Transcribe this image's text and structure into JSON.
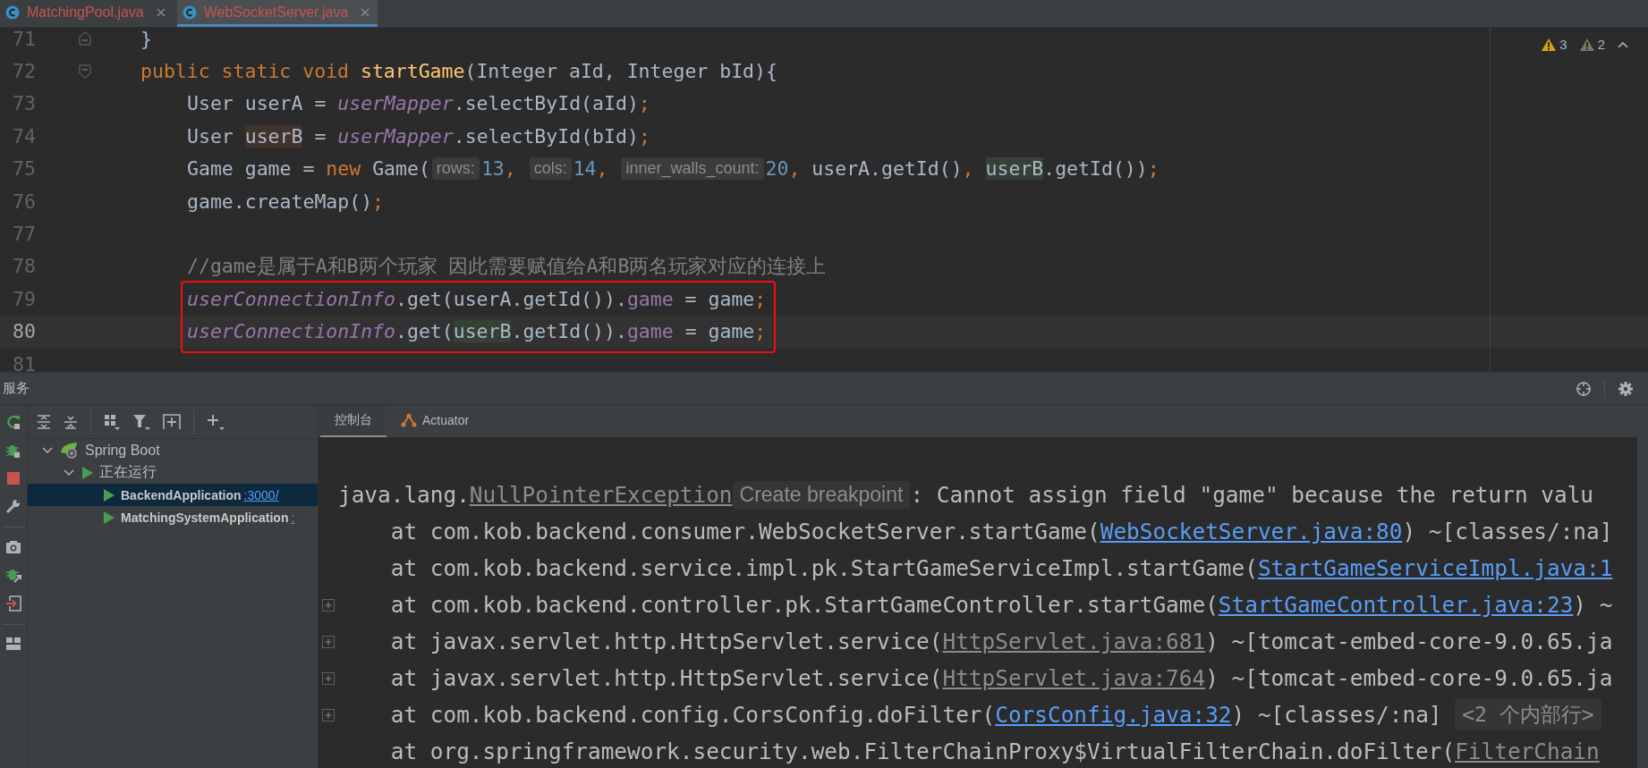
{
  "tabs": [
    {
      "label": "MatchingPool.java",
      "selected": false
    },
    {
      "label": "WebSocketServer.java",
      "selected": true
    }
  ],
  "editor": {
    "inspections": [
      {
        "kind": "warning",
        "count": "3"
      },
      {
        "kind": "weak_warning",
        "count": "2"
      }
    ],
    "lines": [
      {
        "number": "71",
        "current": false,
        "boxed": false,
        "fold": {
          "kind": "end"
        },
        "tokens": [
          {
            "t": "}",
            "kind": "plain"
          }
        ]
      },
      {
        "number": "72",
        "current": false,
        "boxed": false,
        "fold": {
          "kind": "start"
        },
        "tokens": [
          {
            "t": "public static void ",
            "kind": "kw"
          },
          {
            "t": "startGame",
            "kind": "fn"
          },
          {
            "t": "(Integer aId, Integer bId){",
            "kind": "plain"
          }
        ],
        "children": [
          {
            "number": "73",
            "current": false,
            "boxed": false,
            "tokens": [
              {
                "t": "User userA = ",
                "kind": "plain"
              },
              {
                "t": "userMapper",
                "kind": "field"
              },
              {
                "t": ".selectById(aId)",
                "kind": "plain"
              },
              {
                "t": ";",
                "kind": "punct"
              }
            ]
          },
          {
            "number": "74",
            "current": false,
            "boxed": false,
            "tokens": [
              {
                "t": "User ",
                "kind": "plain"
              },
              {
                "t": "userB",
                "kind": "usage_write"
              },
              {
                "t": " = ",
                "kind": "plain"
              },
              {
                "t": "userMapper",
                "kind": "field"
              },
              {
                "t": ".selectById(bId)",
                "kind": "plain"
              },
              {
                "t": ";",
                "kind": "punct"
              }
            ]
          },
          {
            "number": "75",
            "current": false,
            "boxed": false,
            "tokens": [
              {
                "t": "Game game = ",
                "kind": "plain"
              },
              {
                "t": "new ",
                "kind": "kw"
              },
              {
                "t": "Game(",
                "kind": "plain"
              },
              {
                "t": "rows:",
                "kind": "hint"
              },
              {
                "t": "13",
                "kind": "num"
              },
              {
                "t": ", ",
                "kind": "punct"
              },
              {
                "t": "cols:",
                "kind": "hint"
              },
              {
                "t": "14",
                "kind": "num"
              },
              {
                "t": ", ",
                "kind": "punct"
              },
              {
                "t": "inner_walls_count:",
                "kind": "hint"
              },
              {
                "t": "20",
                "kind": "num"
              },
              {
                "t": ", ",
                "kind": "punct"
              },
              {
                "t": "userA.getId()",
                "kind": "plain"
              },
              {
                "t": ", ",
                "kind": "punct"
              },
              {
                "t": "userB",
                "kind": "usage_read"
              },
              {
                "t": ".getId())",
                "kind": "plain"
              },
              {
                "t": ";",
                "kind": "punct"
              }
            ]
          },
          {
            "number": "76",
            "current": false,
            "boxed": false,
            "tokens": [
              {
                "t": "game.createMap()",
                "kind": "plain"
              },
              {
                "t": ";",
                "kind": "punct"
              }
            ]
          },
          {
            "number": "77",
            "current": false,
            "boxed": false
          },
          {
            "number": "78",
            "current": false,
            "boxed": false,
            "tokens": [
              {
                "t": "//game是属于A和B两个玩家 因此需要赋值给A和B两名玩家对应的连接上",
                "kind": "comment"
              }
            ]
          },
          {
            "number": "79",
            "current": false,
            "boxed": true,
            "tokens": [
              {
                "t": "userConnectionInfo",
                "kind": "field"
              },
              {
                "t": ".get(userA.getId()).",
                "kind": "plain"
              },
              {
                "t": "game",
                "kind": "prop"
              },
              {
                "t": " = game",
                "kind": "plain"
              },
              {
                "t": ";",
                "kind": "punct"
              }
            ]
          },
          {
            "number": "80",
            "current": true,
            "boxed": true,
            "tokens": [
              {
                "t": "userConnectionInfo",
                "kind": "field"
              },
              {
                "t": ".get(",
                "kind": "plain"
              },
              {
                "t": "userB",
                "kind": "usage_read"
              },
              {
                "t": ".getId()).",
                "kind": "plain"
              },
              {
                "t": "game",
                "kind": "prop"
              },
              {
                "t": " = game",
                "kind": "plain"
              },
              {
                "t": ";",
                "kind": "punct"
              }
            ]
          },
          {
            "number": "81",
            "current": false,
            "boxed": false
          }
        ]
      }
    ]
  },
  "services": {
    "title": "服务",
    "tree": [
      {
        "label": "Spring Boot",
        "expanded": true,
        "children": [
          {
            "label": "正在运行",
            "expanded": true,
            "children": [
              {
                "label": "BackendApplication",
                "link": ":3000/",
                "selected": true
              },
              {
                "label": "MatchingSystemApplication",
                "link": ":",
                "selected": false
              }
            ]
          }
        ]
      }
    ],
    "console_tabs": [
      {
        "label": "控制台",
        "selected": true
      },
      {
        "label": "Actuator",
        "selected": false
      }
    ],
    "console": [
      {
        "foldable": false,
        "tokens": [
          {
            "t": "java.lang.",
            "kind": "text"
          },
          {
            "t": "NullPointerException",
            "kind": "grey_link"
          },
          {
            "t": "Create breakpoint",
            "kind": "hint"
          },
          {
            "t": ": Cannot assign field \"game\" because the return valu",
            "kind": "text"
          }
        ]
      },
      {
        "foldable": false,
        "tokens": [
          {
            "t": "    at com.kob.backend.consumer.WebSocketServer.startGame(",
            "kind": "text"
          },
          {
            "t": "WebSocketServer.java:80",
            "kind": "link"
          },
          {
            "t": ") ~[classes/:na]",
            "kind": "text"
          }
        ]
      },
      {
        "foldable": false,
        "tokens": [
          {
            "t": "    at com.kob.backend.service.impl.pk.StartGameServiceImpl.startGame(",
            "kind": "text"
          },
          {
            "t": "StartGameServiceImpl.java:1",
            "kind": "link"
          }
        ]
      },
      {
        "foldable": true,
        "tokens": [
          {
            "t": "    at com.kob.backend.controller.pk.StartGameController.startGame(",
            "kind": "text"
          },
          {
            "t": "StartGameController.java:23",
            "kind": "link"
          },
          {
            "t": ") ~",
            "kind": "text"
          }
        ]
      },
      {
        "foldable": true,
        "tokens": [
          {
            "t": "    at javax.servlet.http.HttpServlet.service(",
            "kind": "text"
          },
          {
            "t": "HttpServlet.java:681",
            "kind": "grey_link"
          },
          {
            "t": ") ~[tomcat-embed-core-9.0.65.ja",
            "kind": "text"
          }
        ]
      },
      {
        "foldable": true,
        "tokens": [
          {
            "t": "    at javax.servlet.http.HttpServlet.service(",
            "kind": "text"
          },
          {
            "t": "HttpServlet.java:764",
            "kind": "grey_link"
          },
          {
            "t": ") ~[tomcat-embed-core-9.0.65.ja",
            "kind": "text"
          }
        ]
      },
      {
        "foldable": true,
        "tokens": [
          {
            "t": "    at com.kob.backend.config.CorsConfig.doFilter(",
            "kind": "text"
          },
          {
            "t": "CorsConfig.java:32",
            "kind": "link"
          },
          {
            "t": ") ~[classes/:na] ",
            "kind": "text"
          },
          {
            "t": "<2 个内部行>",
            "kind": "hint"
          }
        ]
      },
      {
        "foldable": false,
        "tokens": [
          {
            "t": "    at org.springframework.security.web.FilterChainProxy$VirtualFilterChain.doFilter(",
            "kind": "text"
          },
          {
            "t": "FilterChain",
            "kind": "grey_link"
          }
        ]
      }
    ]
  }
}
